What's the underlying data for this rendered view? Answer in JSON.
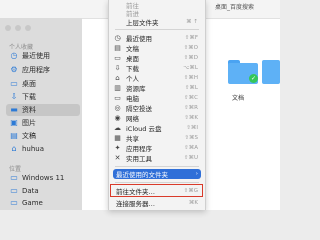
{
  "finder": {
    "path_text": "桌面_百度搜索",
    "sidebar": {
      "personal_label": "个人收藏",
      "items": [
        {
          "label": "最近使用",
          "icon": "clock-icon",
          "selected": false
        },
        {
          "label": "应用程序",
          "icon": "apps-icon",
          "selected": false
        },
        {
          "label": "桌面",
          "icon": "desktop-icon",
          "selected": false
        },
        {
          "label": "下载",
          "icon": "download-icon",
          "selected": false
        },
        {
          "label": "资料",
          "icon": "folder-icon",
          "selected": true
        },
        {
          "label": "图片",
          "icon": "photo-icon",
          "selected": false
        },
        {
          "label": "文稿",
          "icon": "document-icon",
          "selected": false
        },
        {
          "label": "huhua",
          "icon": "home-icon",
          "selected": false
        }
      ],
      "locations_label": "位置",
      "locations": [
        {
          "label": "Windows 11",
          "icon": "disk-icon"
        },
        {
          "label": "Data",
          "icon": "disk-icon"
        },
        {
          "label": "Game",
          "icon": "disk-icon"
        }
      ]
    },
    "content": {
      "folder_label": "文档"
    }
  },
  "menu": {
    "items": [
      {
        "label": "前往",
        "icon": "",
        "shortcut": "",
        "disabled": true
      },
      {
        "label": "前进",
        "icon": "",
        "shortcut": "",
        "disabled": true
      },
      {
        "label": "上层文件夹",
        "icon": "",
        "shortcut": "⌘ ↑",
        "disabled": false
      },
      {
        "label": "最近使用",
        "icon": "clock-icon",
        "shortcut": "⇧⌘F",
        "disabled": false
      },
      {
        "label": "文稿",
        "icon": "document-icon",
        "shortcut": "⇧⌘O",
        "disabled": false
      },
      {
        "label": "桌面",
        "icon": "desktop-icon",
        "shortcut": "⇧⌘D",
        "disabled": false
      },
      {
        "label": "下载",
        "icon": "download-icon",
        "shortcut": "⌥⌘L",
        "disabled": false
      },
      {
        "label": "个人",
        "icon": "home-icon",
        "shortcut": "⇧⌘H",
        "disabled": false
      },
      {
        "label": "资源库",
        "icon": "library-icon",
        "shortcut": "⇧⌘L",
        "disabled": false
      },
      {
        "label": "电脑",
        "icon": "computer-icon",
        "shortcut": "⇧⌘C",
        "disabled": false
      },
      {
        "label": "隔空投送",
        "icon": "airdrop-icon",
        "shortcut": "⇧⌘R",
        "disabled": false
      },
      {
        "label": "网络",
        "icon": "network-icon",
        "shortcut": "⇧⌘K",
        "disabled": false
      },
      {
        "label": "iCloud 云盘",
        "icon": "cloud-icon",
        "shortcut": "⇧⌘I",
        "disabled": false
      },
      {
        "label": "共享",
        "icon": "shared-icon",
        "shortcut": "⇧⌘S",
        "disabled": false
      },
      {
        "label": "应用程序",
        "icon": "apps-icon",
        "shortcut": "⇧⌘A",
        "disabled": false
      },
      {
        "label": "实用工具",
        "icon": "tools-icon",
        "shortcut": "⇧⌘U",
        "disabled": false
      }
    ],
    "recent_folders": {
      "label": "最近使用的文件夹",
      "arrow": "›"
    },
    "goto_folder": {
      "label": "前往文件夹…",
      "shortcut": "⇧⌘G"
    },
    "connect_server": {
      "label": "连接服务器…",
      "shortcut": "⌘K"
    }
  },
  "colors": {
    "highlight": "#2f6fd8",
    "annotation_box": "#d93a2a",
    "folder_blue": "#5eb1f6"
  }
}
